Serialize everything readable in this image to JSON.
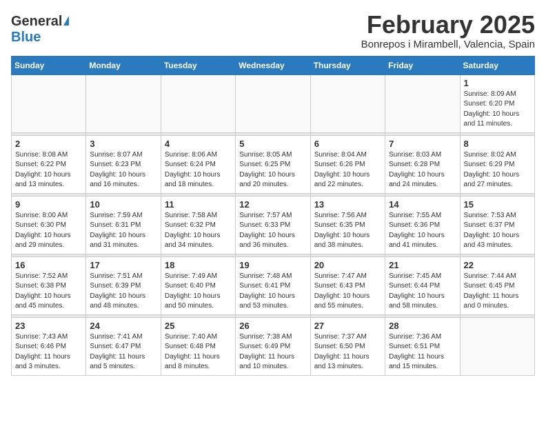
{
  "header": {
    "logo_general": "General",
    "logo_blue": "Blue",
    "month_year": "February 2025",
    "location": "Bonrepos i Mirambell, Valencia, Spain"
  },
  "weekdays": [
    "Sunday",
    "Monday",
    "Tuesday",
    "Wednesday",
    "Thursday",
    "Friday",
    "Saturday"
  ],
  "weeks": [
    [
      {
        "day": "",
        "info": ""
      },
      {
        "day": "",
        "info": ""
      },
      {
        "day": "",
        "info": ""
      },
      {
        "day": "",
        "info": ""
      },
      {
        "day": "",
        "info": ""
      },
      {
        "day": "",
        "info": ""
      },
      {
        "day": "1",
        "info": "Sunrise: 8:09 AM\nSunset: 6:20 PM\nDaylight: 10 hours\nand 11 minutes."
      }
    ],
    [
      {
        "day": "2",
        "info": "Sunrise: 8:08 AM\nSunset: 6:22 PM\nDaylight: 10 hours\nand 13 minutes."
      },
      {
        "day": "3",
        "info": "Sunrise: 8:07 AM\nSunset: 6:23 PM\nDaylight: 10 hours\nand 16 minutes."
      },
      {
        "day": "4",
        "info": "Sunrise: 8:06 AM\nSunset: 6:24 PM\nDaylight: 10 hours\nand 18 minutes."
      },
      {
        "day": "5",
        "info": "Sunrise: 8:05 AM\nSunset: 6:25 PM\nDaylight: 10 hours\nand 20 minutes."
      },
      {
        "day": "6",
        "info": "Sunrise: 8:04 AM\nSunset: 6:26 PM\nDaylight: 10 hours\nand 22 minutes."
      },
      {
        "day": "7",
        "info": "Sunrise: 8:03 AM\nSunset: 6:28 PM\nDaylight: 10 hours\nand 24 minutes."
      },
      {
        "day": "8",
        "info": "Sunrise: 8:02 AM\nSunset: 6:29 PM\nDaylight: 10 hours\nand 27 minutes."
      }
    ],
    [
      {
        "day": "9",
        "info": "Sunrise: 8:00 AM\nSunset: 6:30 PM\nDaylight: 10 hours\nand 29 minutes."
      },
      {
        "day": "10",
        "info": "Sunrise: 7:59 AM\nSunset: 6:31 PM\nDaylight: 10 hours\nand 31 minutes."
      },
      {
        "day": "11",
        "info": "Sunrise: 7:58 AM\nSunset: 6:32 PM\nDaylight: 10 hours\nand 34 minutes."
      },
      {
        "day": "12",
        "info": "Sunrise: 7:57 AM\nSunset: 6:33 PM\nDaylight: 10 hours\nand 36 minutes."
      },
      {
        "day": "13",
        "info": "Sunrise: 7:56 AM\nSunset: 6:35 PM\nDaylight: 10 hours\nand 38 minutes."
      },
      {
        "day": "14",
        "info": "Sunrise: 7:55 AM\nSunset: 6:36 PM\nDaylight: 10 hours\nand 41 minutes."
      },
      {
        "day": "15",
        "info": "Sunrise: 7:53 AM\nSunset: 6:37 PM\nDaylight: 10 hours\nand 43 minutes."
      }
    ],
    [
      {
        "day": "16",
        "info": "Sunrise: 7:52 AM\nSunset: 6:38 PM\nDaylight: 10 hours\nand 45 minutes."
      },
      {
        "day": "17",
        "info": "Sunrise: 7:51 AM\nSunset: 6:39 PM\nDaylight: 10 hours\nand 48 minutes."
      },
      {
        "day": "18",
        "info": "Sunrise: 7:49 AM\nSunset: 6:40 PM\nDaylight: 10 hours\nand 50 minutes."
      },
      {
        "day": "19",
        "info": "Sunrise: 7:48 AM\nSunset: 6:41 PM\nDaylight: 10 hours\nand 53 minutes."
      },
      {
        "day": "20",
        "info": "Sunrise: 7:47 AM\nSunset: 6:43 PM\nDaylight: 10 hours\nand 55 minutes."
      },
      {
        "day": "21",
        "info": "Sunrise: 7:45 AM\nSunset: 6:44 PM\nDaylight: 10 hours\nand 58 minutes."
      },
      {
        "day": "22",
        "info": "Sunrise: 7:44 AM\nSunset: 6:45 PM\nDaylight: 11 hours\nand 0 minutes."
      }
    ],
    [
      {
        "day": "23",
        "info": "Sunrise: 7:43 AM\nSunset: 6:46 PM\nDaylight: 11 hours\nand 3 minutes."
      },
      {
        "day": "24",
        "info": "Sunrise: 7:41 AM\nSunset: 6:47 PM\nDaylight: 11 hours\nand 5 minutes."
      },
      {
        "day": "25",
        "info": "Sunrise: 7:40 AM\nSunset: 6:48 PM\nDaylight: 11 hours\nand 8 minutes."
      },
      {
        "day": "26",
        "info": "Sunrise: 7:38 AM\nSunset: 6:49 PM\nDaylight: 11 hours\nand 10 minutes."
      },
      {
        "day": "27",
        "info": "Sunrise: 7:37 AM\nSunset: 6:50 PM\nDaylight: 11 hours\nand 13 minutes."
      },
      {
        "day": "28",
        "info": "Sunrise: 7:36 AM\nSunset: 6:51 PM\nDaylight: 11 hours\nand 15 minutes."
      },
      {
        "day": "",
        "info": ""
      }
    ]
  ]
}
